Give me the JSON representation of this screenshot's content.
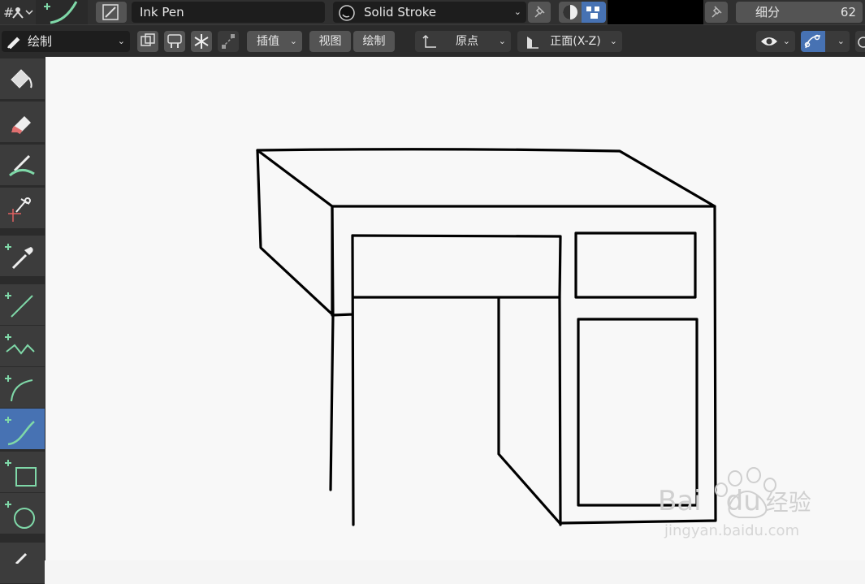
{
  "header": {
    "brush_name": "Ink Pen",
    "stroke_material": "Solid Stroke",
    "subdivision_label": "细分",
    "subdivision_value": "62"
  },
  "toolheader": {
    "mode": "绘制",
    "interpolate": "插值",
    "view": "视图",
    "draw": "绘制",
    "origin": "原点",
    "orientation": "正面(X-Z)"
  },
  "tools": [
    "fill-tool",
    "erase-tool",
    "tint-tool",
    "cutter-tool",
    "eyedropper-tool",
    "line-tool",
    "polyline-tool",
    "arc-tool",
    "curve-tool",
    "box-tool",
    "circle-tool",
    "annotate-tool"
  ],
  "active_tool": "curve-tool",
  "colors": {
    "accent": "#4772b3",
    "panel": "#303030",
    "field": "#1d1d1d",
    "tool_green": "#7fd8a8",
    "canvas": "#f8f8f8",
    "stroke": "#000000"
  },
  "watermark": {
    "brand": "Bai",
    "brand2": "du",
    "suffix": "经验",
    "url": "jingyan.baidu.com"
  }
}
